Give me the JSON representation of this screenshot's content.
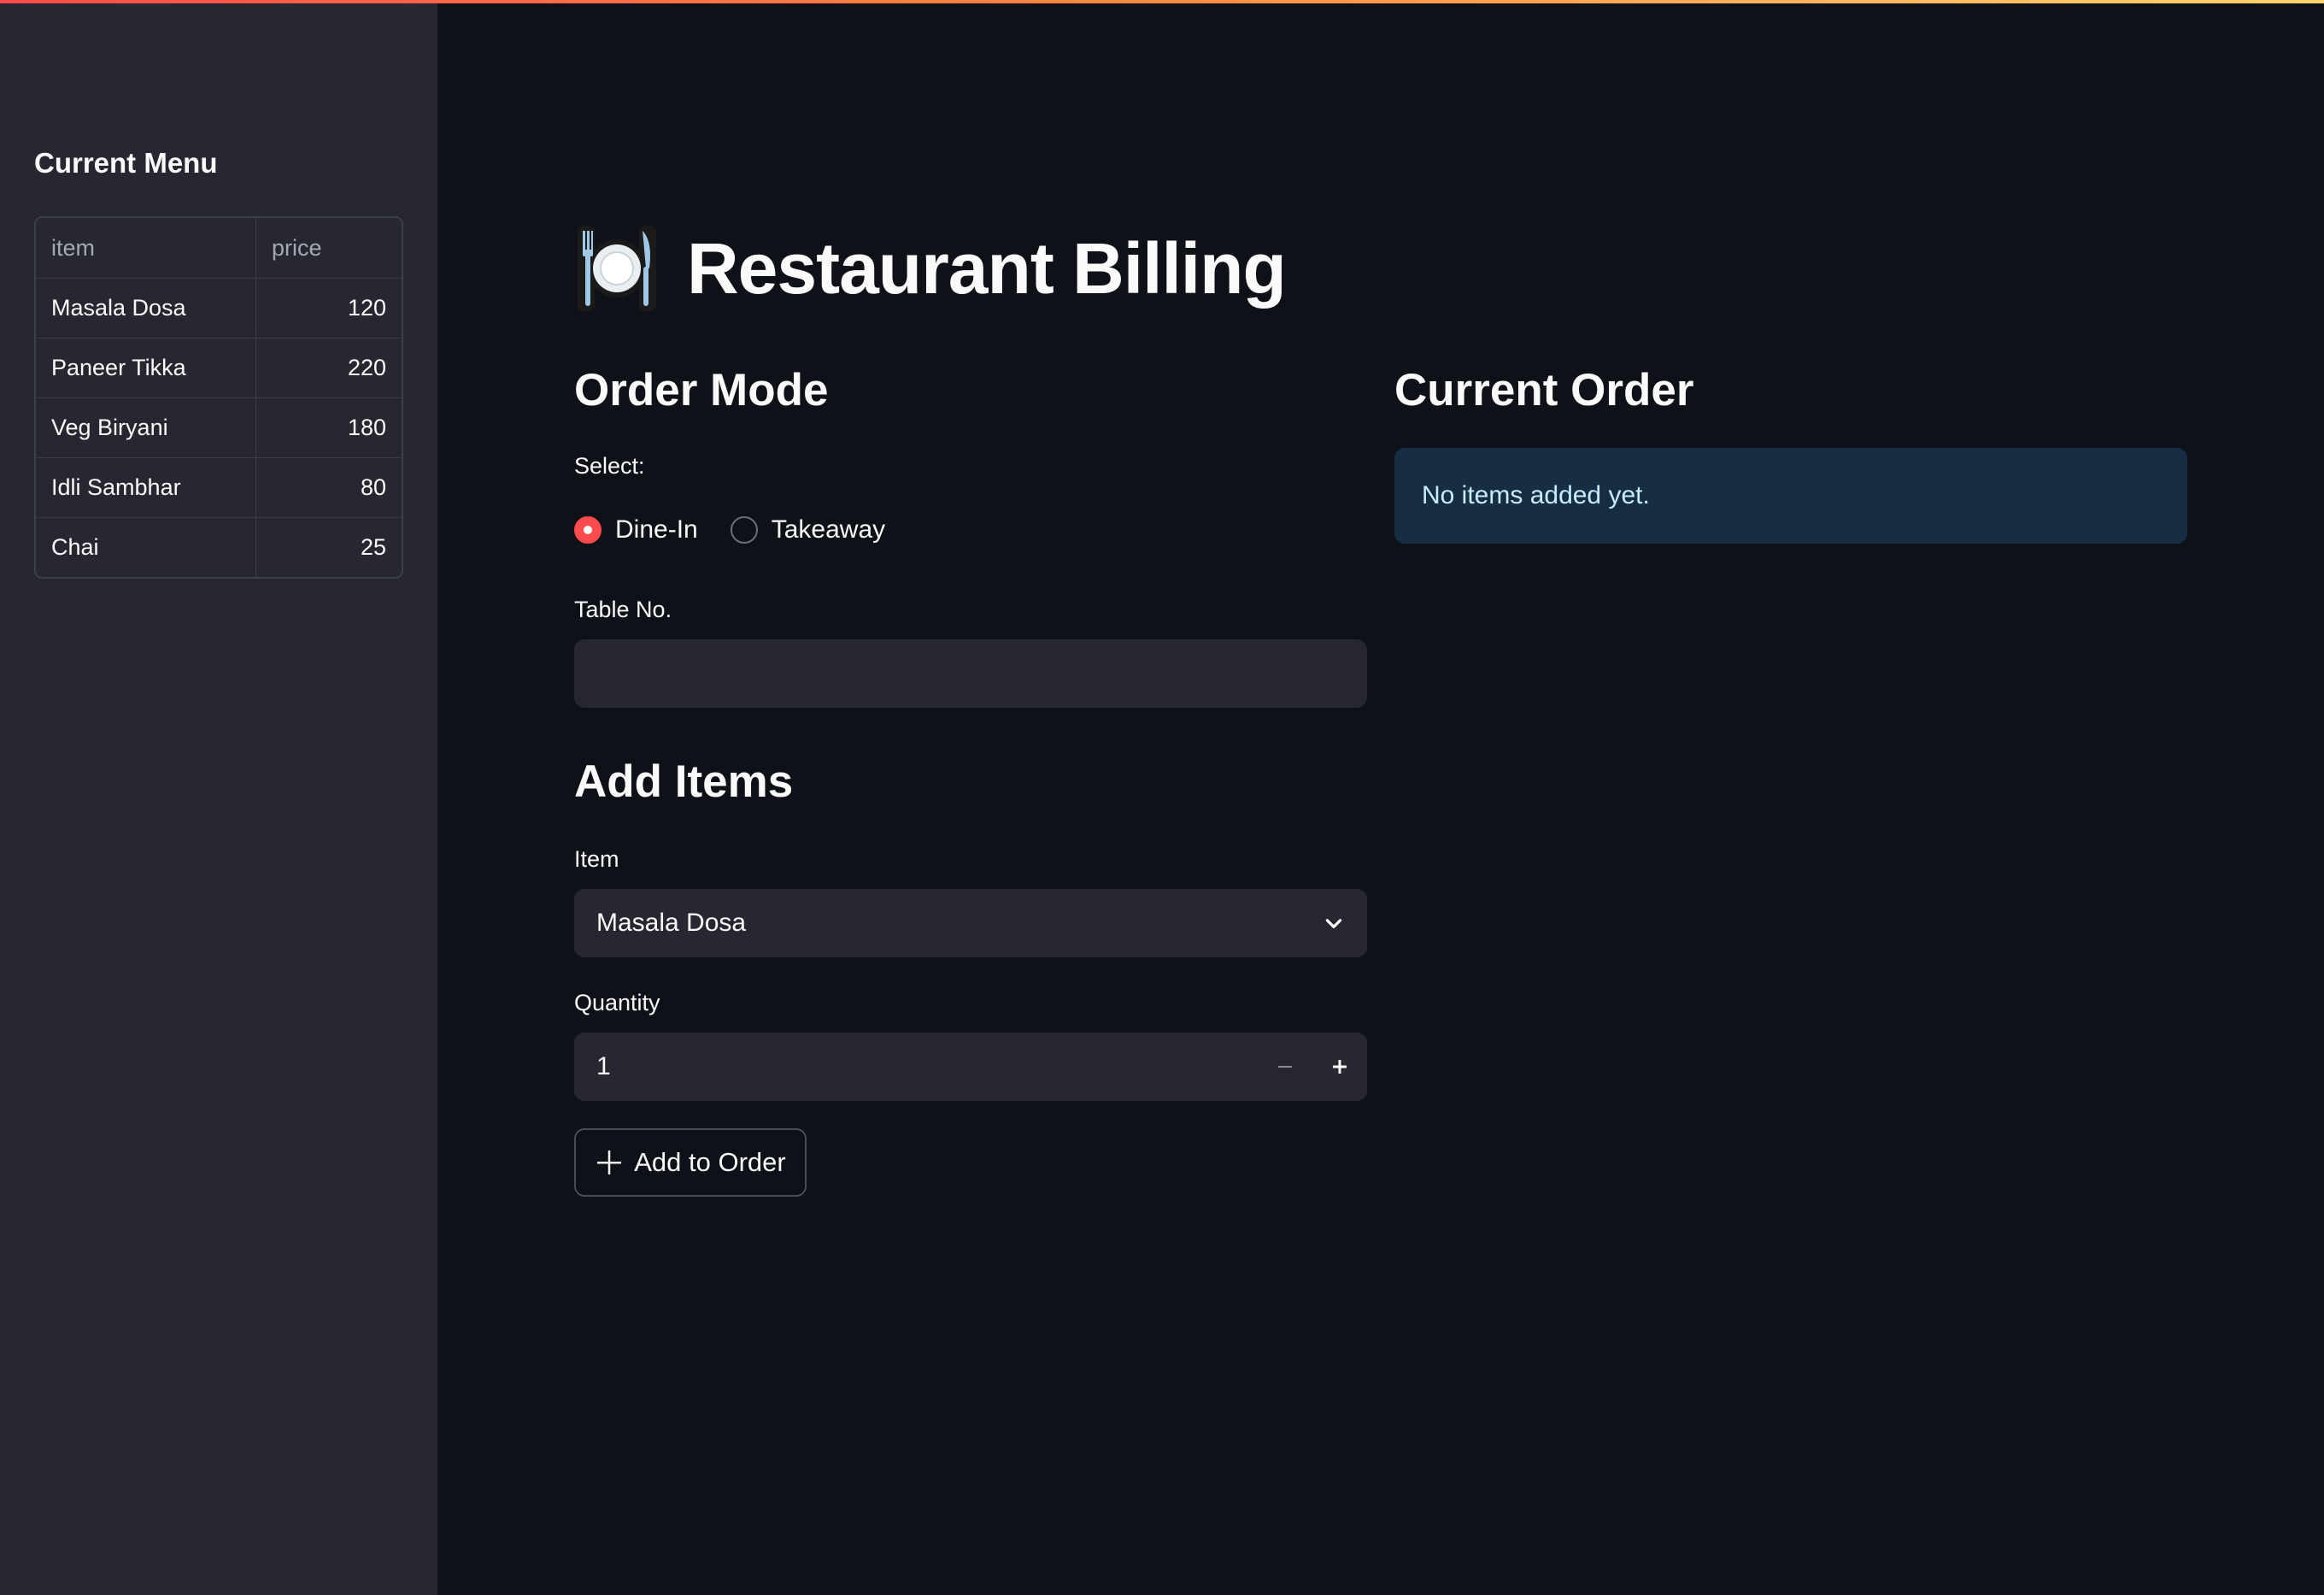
{
  "sidebar": {
    "title": "Current Menu",
    "table": {
      "columns": [
        "item",
        "price"
      ],
      "rows": [
        {
          "item": "Masala Dosa",
          "price": "120"
        },
        {
          "item": "Paneer Tikka",
          "price": "220"
        },
        {
          "item": "Veg Biryani",
          "price": "180"
        },
        {
          "item": "Idli Sambhar",
          "price": "80"
        },
        {
          "item": "Chai",
          "price": "25"
        }
      ]
    }
  },
  "main": {
    "title": "Restaurant Billing",
    "title_icon": "fork-knife-plate-icon",
    "order_mode": {
      "heading": "Order Mode",
      "select_label": "Select:",
      "options": [
        {
          "label": "Dine-In",
          "selected": true
        },
        {
          "label": "Takeaway",
          "selected": false
        }
      ],
      "table_no_label": "Table No.",
      "table_no_value": ""
    },
    "add_items": {
      "heading": "Add Items",
      "item_label": "Item",
      "item_selected": "Masala Dosa",
      "quantity_label": "Quantity",
      "quantity_value": "1",
      "add_button_label": "Add to Order"
    },
    "current_order": {
      "heading": "Current Order",
      "empty_message": "No items added yet."
    }
  },
  "colors": {
    "background": "#0e1117",
    "sidebar": "#262730",
    "input": "#262730",
    "accent": "#ff4b4b",
    "info_bg": "#172d43",
    "info_text": "#c7ebff"
  }
}
